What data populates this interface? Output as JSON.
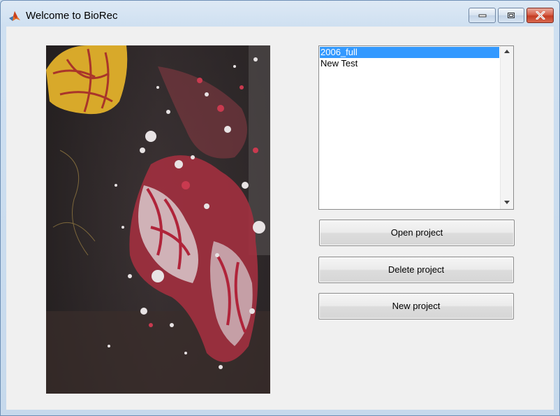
{
  "window": {
    "title": "Welcome to BioRec",
    "app_icon": "matlab-logo-icon",
    "controls": [
      "minimize-icon",
      "maximize-icon",
      "close-icon"
    ]
  },
  "preview": {
    "description_icon": "specimen-photo"
  },
  "project_list": {
    "items": [
      {
        "label": "2006_full",
        "selected": true
      },
      {
        "label": "New Test",
        "selected": false
      }
    ]
  },
  "buttons": {
    "open": "Open project",
    "delete": "Delete project",
    "new": "New project"
  },
  "colors": {
    "selection": "#3399ff",
    "client_background": "#f0f0f0",
    "close_button": "#c23b22"
  }
}
